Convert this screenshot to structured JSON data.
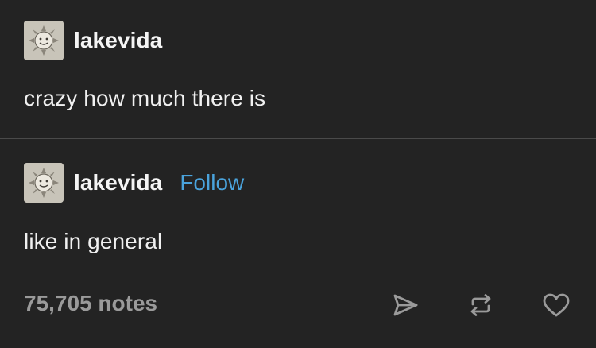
{
  "posts": [
    {
      "username": "lakevida",
      "text": "crazy how much there is",
      "avatar_icon": "smiling-sun-avatar-icon"
    },
    {
      "username": "lakevida",
      "follow_label": "Follow",
      "text": "like in general",
      "avatar_icon": "smiling-sun-avatar-icon"
    }
  ],
  "footer": {
    "notes": "75,705 notes",
    "actions": [
      "share-icon",
      "reblog-icon",
      "heart-icon"
    ]
  },
  "colors": {
    "background": "#232323",
    "text": "#f1f1f1",
    "muted": "#9a9a9a",
    "accent": "#4aa3dc",
    "divider": "#4a4a4a"
  }
}
